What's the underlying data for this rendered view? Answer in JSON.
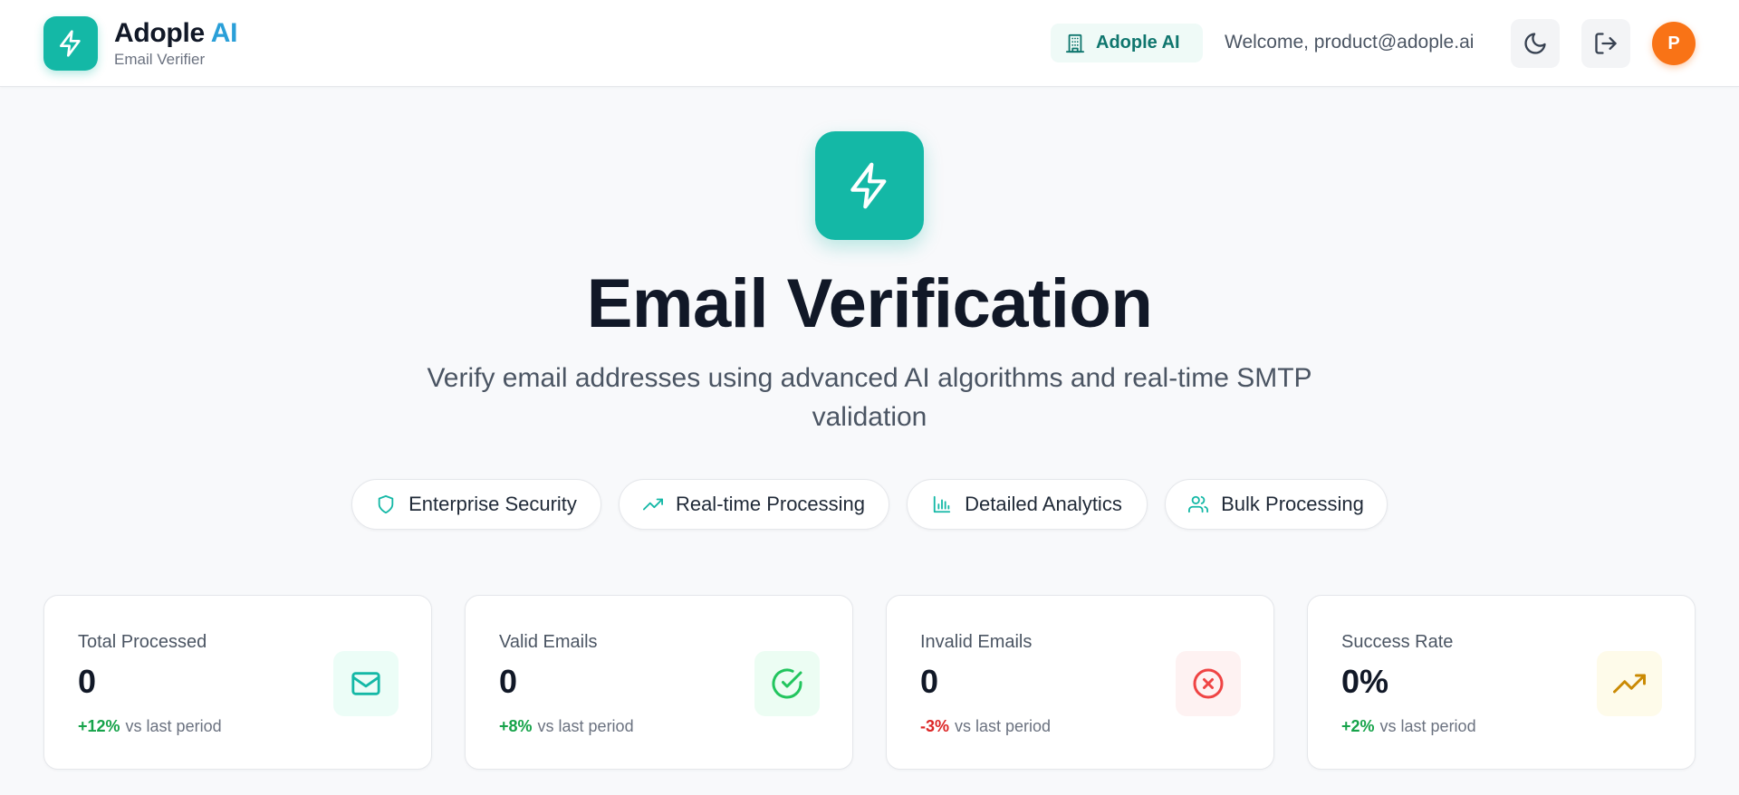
{
  "header": {
    "brand": {
      "name": "Adople",
      "accent": "AI",
      "subtitle": "Email Verifier"
    },
    "org_badge": "Adople AI",
    "welcome": "Welcome, product@adople.ai",
    "avatar_initial": "P"
  },
  "hero": {
    "title": "Email Verification",
    "subtitle": "Verify email addresses using advanced AI algorithms and real-time SMTP validation"
  },
  "features": [
    {
      "label": "Enterprise Security",
      "icon": "shield-icon"
    },
    {
      "label": "Real-time Processing",
      "icon": "trending-up-icon"
    },
    {
      "label": "Detailed Analytics",
      "icon": "bar-chart-icon"
    },
    {
      "label": "Bulk Processing",
      "icon": "users-icon"
    }
  ],
  "stats": [
    {
      "label": "Total Processed",
      "value": "0",
      "delta": "+12%",
      "trend_text": "vs last period",
      "icon": "mail-icon",
      "delta_color": "#16a34a",
      "icon_bg": "#ecfdf7",
      "icon_color": "#14b8a6"
    },
    {
      "label": "Valid Emails",
      "value": "0",
      "delta": "+8%",
      "trend_text": "vs last period",
      "icon": "check-circle-icon",
      "delta_color": "#16a34a",
      "icon_bg": "#ecfdf3",
      "icon_color": "#22c55e"
    },
    {
      "label": "Invalid Emails",
      "value": "0",
      "delta": "-3%",
      "trend_text": "vs last period",
      "icon": "x-circle-icon",
      "delta_color": "#dc2626",
      "icon_bg": "#fef2f2",
      "icon_color": "#ef4444"
    },
    {
      "label": "Success Rate",
      "value": "0%",
      "delta": "+2%",
      "trend_text": "vs last period",
      "icon": "trending-up-icon",
      "delta_color": "#16a34a",
      "icon_bg": "#fefbea",
      "icon_color": "#ca8a04"
    }
  ],
  "colors": {
    "primary": "#14b8a6",
    "brand_accent": "#2a9fd8",
    "avatar": "#f97316"
  }
}
